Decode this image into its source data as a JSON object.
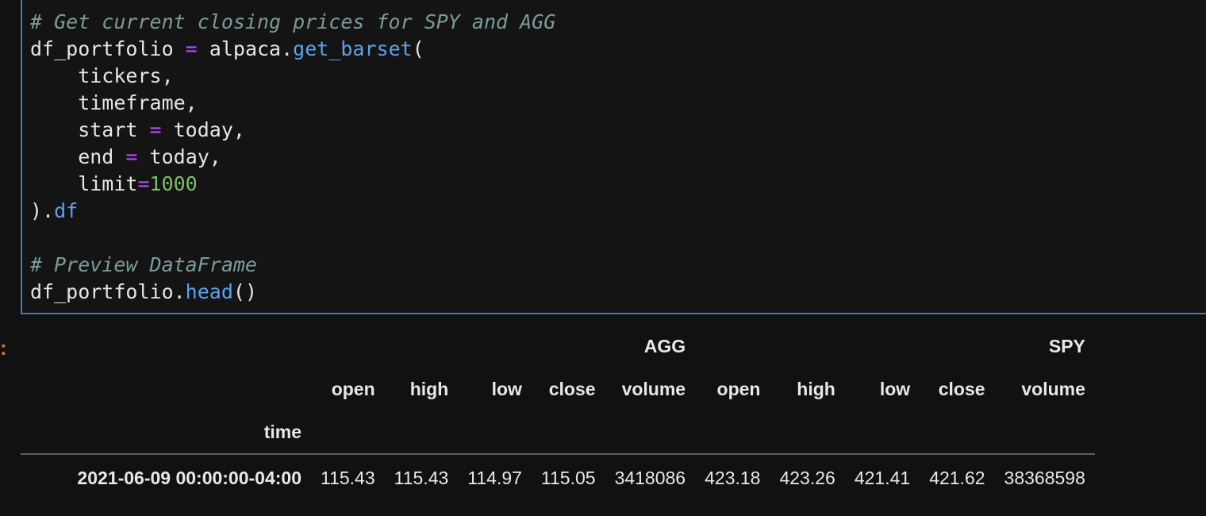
{
  "code_cell": {
    "lines": [
      [
        {
          "t": "# Get current closing prices for SPY and AGG",
          "c": "cm"
        }
      ],
      [
        {
          "t": "df_portfolio ",
          "c": ""
        },
        {
          "t": "=",
          "c": "op"
        },
        {
          "t": " alpaca.",
          "c": ""
        },
        {
          "t": "get_barset",
          "c": "fn"
        },
        {
          "t": "(",
          "c": ""
        }
      ],
      [
        {
          "t": "    tickers,",
          "c": ""
        }
      ],
      [
        {
          "t": "    timeframe,",
          "c": ""
        }
      ],
      [
        {
          "t": "    start ",
          "c": ""
        },
        {
          "t": "=",
          "c": "op"
        },
        {
          "t": " today,",
          "c": ""
        }
      ],
      [
        {
          "t": "    end ",
          "c": ""
        },
        {
          "t": "=",
          "c": "op"
        },
        {
          "t": " today,",
          "c": ""
        }
      ],
      [
        {
          "t": "    limit",
          "c": ""
        },
        {
          "t": "=",
          "c": "op"
        },
        {
          "t": "1000",
          "c": "num"
        }
      ],
      [
        {
          "t": ").",
          "c": ""
        },
        {
          "t": "df",
          "c": "fn"
        }
      ],
      [],
      [
        {
          "t": "# Preview DataFrame",
          "c": "cm"
        }
      ],
      [
        {
          "t": "df_portfolio.",
          "c": ""
        },
        {
          "t": "head",
          "c": "fn"
        },
        {
          "t": "()",
          "c": ""
        }
      ]
    ]
  },
  "output": {
    "prompt_mark": ":",
    "groups": [
      {
        "label": "AGG",
        "span": 5
      },
      {
        "label": "SPY",
        "span": 5
      }
    ],
    "columns": [
      "open",
      "high",
      "low",
      "close",
      "volume",
      "open",
      "high",
      "low",
      "close",
      "volume"
    ],
    "index_name": "time",
    "rows": [
      {
        "index": "2021-06-09 00:00:00-04:00",
        "values": [
          "115.43",
          "115.43",
          "114.97",
          "115.05",
          "3418086",
          "423.18",
          "423.26",
          "421.41",
          "421.62",
          "38368598"
        ]
      }
    ]
  },
  "colors": {
    "background": "#111111",
    "cell_border": "#3d7dc4",
    "comment": "#7c9b9b",
    "operator": "#b34cff",
    "function": "#5aa2ee",
    "number": "#7fbf6a",
    "prompt": "#d9704f"
  }
}
